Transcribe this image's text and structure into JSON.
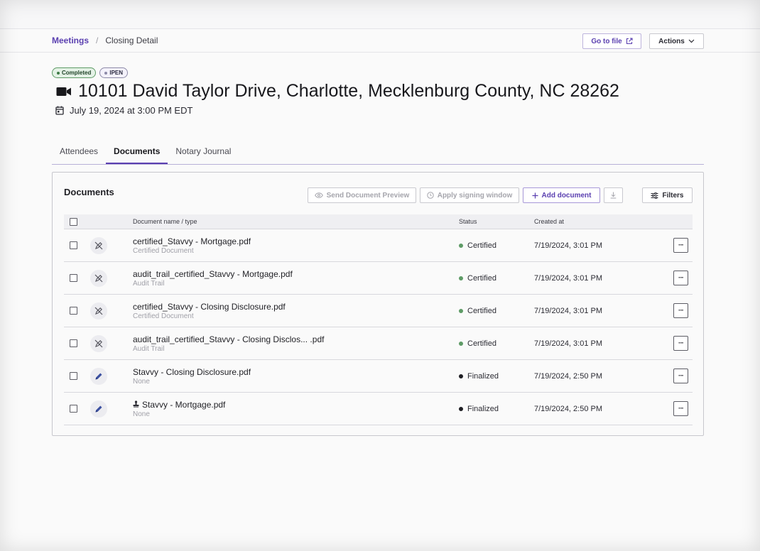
{
  "breadcrumb": {
    "root": "Meetings",
    "separator": "/",
    "current": "Closing Detail"
  },
  "header": {
    "goto_label": "Go to file",
    "actions_label": "Actions"
  },
  "badges": [
    {
      "label": "Completed"
    },
    {
      "label": "IPEN"
    }
  ],
  "meeting": {
    "title": "10101 David Taylor Drive, Charlotte, Mecklenburg County, NC 28262",
    "datetime": "July 19, 2024 at 3:00 PM EDT"
  },
  "tabs": [
    {
      "label": "Attendees",
      "active": false
    },
    {
      "label": "Documents",
      "active": true
    },
    {
      "label": "Notary Journal",
      "active": false
    }
  ],
  "documents_panel": {
    "title": "Documents",
    "buttons": {
      "send_preview": "Send Document Preview",
      "apply_window": "Apply signing window",
      "add_document": "Add document",
      "filters": "Filters"
    },
    "columns": {
      "name": "Document name / type",
      "status": "Status",
      "created": "Created at"
    },
    "rows": [
      {
        "name": "certified_Stavvy - Mortgage.pdf",
        "type": "Certified Document",
        "status": "Certified",
        "created": "7/19/2024, 3:01 PM",
        "icon": "edit-disabled-icon",
        "stamp": false
      },
      {
        "name": "audit_trail_certified_Stavvy - Mortgage.pdf",
        "type": "Audit Trail",
        "status": "Certified",
        "created": "7/19/2024, 3:01 PM",
        "icon": "edit-disabled-icon",
        "stamp": false
      },
      {
        "name": "certified_Stavvy - Closing Disclosure.pdf",
        "type": "Certified Document",
        "status": "Certified",
        "created": "7/19/2024, 3:01 PM",
        "icon": "edit-disabled-icon",
        "stamp": false
      },
      {
        "name": "audit_trail_certified_Stavvy - Closing Disclos... .pdf",
        "type": "Audit Trail",
        "status": "Certified",
        "created": "7/19/2024, 3:01 PM",
        "icon": "edit-disabled-icon",
        "stamp": false
      },
      {
        "name": "Stavvy - Closing Disclosure.pdf",
        "type": "None",
        "status": "Finalized",
        "created": "7/19/2024, 2:50 PM",
        "icon": "pencil-icon",
        "stamp": false
      },
      {
        "name": "Stavvy - Mortgage.pdf",
        "type": "None",
        "status": "Finalized",
        "created": "7/19/2024, 2:50 PM",
        "icon": "pencil-icon",
        "stamp": true
      }
    ]
  },
  "colors": {
    "accent": "#5a3fb0",
    "certified": "#5e9b66",
    "finalized": "#1f1f24"
  }
}
